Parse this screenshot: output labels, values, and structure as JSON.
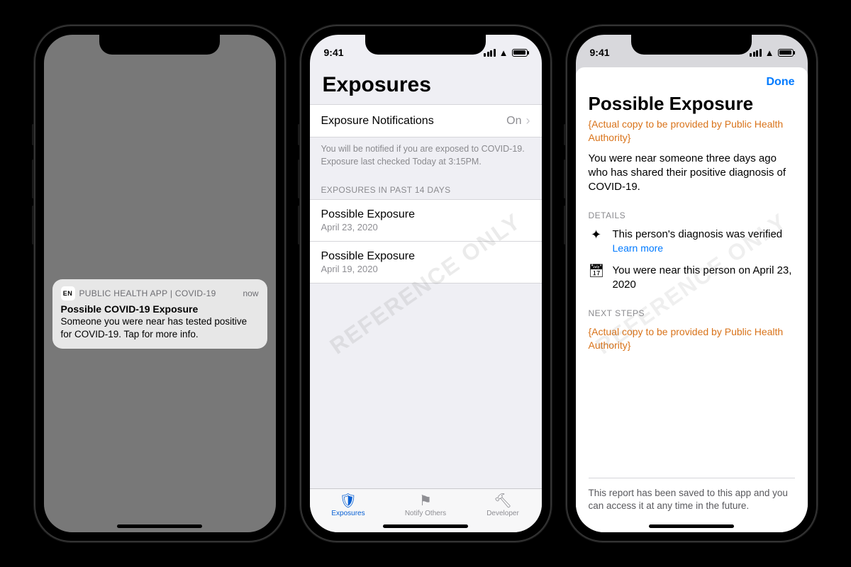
{
  "status_bar": {
    "time": "9:41"
  },
  "watermark": "REFERENCE ONLY",
  "phone1": {
    "notification": {
      "app_badge": "EN",
      "app_name": "PUBLIC HEALTH APP | COVID-19",
      "time": "now",
      "title": "Possible COVID-19 Exposure",
      "body": "Someone you were near has tested positive for COVID-19. Tap for more info."
    }
  },
  "phone2": {
    "title": "Exposures",
    "notif_row": {
      "label": "Exposure Notifications",
      "value": "On"
    },
    "note": "You will be notified if you are exposed to COVID-19. Exposure last checked Today at 3:15PM.",
    "section_header": "EXPOSURES IN PAST 14 DAYS",
    "items": [
      {
        "title": "Possible Exposure",
        "date": "April 23, 2020"
      },
      {
        "title": "Possible Exposure",
        "date": "April 19, 2020"
      }
    ],
    "tabs": {
      "exposures": "Exposures",
      "notify": "Notify Others",
      "developer": "Developer"
    }
  },
  "phone3": {
    "done": "Done",
    "title": "Possible Exposure",
    "placeholder1": "{Actual copy to be provided by Public Health Authority}",
    "description": "You were near someone three days ago who has shared their positive diagnosis of COVID-19.",
    "details_header": "DETAILS",
    "detail_verified": "This person's diagnosis was verified",
    "learn_more": "Learn more",
    "detail_date": "You were near this person on April 23, 2020",
    "next_header": "NEXT STEPS",
    "placeholder2": "{Actual copy to be provided by Public Health Authority}",
    "footer": "This report has been saved to this app and you can access it at any time in the future."
  }
}
